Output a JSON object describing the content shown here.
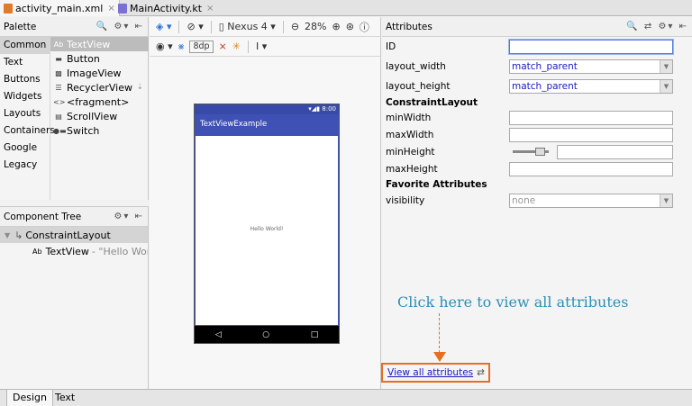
{
  "editor_tabs": [
    {
      "label": "activity_main.xml",
      "close": "×",
      "icon": "xml-file-icon",
      "color": "#e07b2a"
    },
    {
      "label": "MainActivity.kt",
      "close": "×",
      "icon": "kotlin-file-icon",
      "color": "#7b6fd6"
    }
  ],
  "palette": {
    "title": "Palette",
    "tools": "🔍 ⚙▾ ⇤",
    "categories": [
      "Common",
      "Text",
      "Buttons",
      "Widgets",
      "Layouts",
      "Containers",
      "Google",
      "Legacy"
    ],
    "items": [
      {
        "icon": "Ab",
        "label": "TextView"
      },
      {
        "icon": "▬",
        "label": "Button"
      },
      {
        "icon": "▩",
        "label": "ImageView"
      },
      {
        "icon": "☰",
        "label": "RecyclerView"
      },
      {
        "icon": "<>",
        "label": "<fragment>"
      },
      {
        "icon": "▤",
        "label": "ScrollView"
      },
      {
        "icon": "●▬",
        "label": "Switch"
      }
    ],
    "download_icon": "⇣"
  },
  "component_tree": {
    "title": "Component Tree",
    "tools": "⚙▾ ⇤",
    "root": {
      "toggle": "▼",
      "icon": "↳",
      "label": "ConstraintLayout"
    },
    "child": {
      "icon": "Ab",
      "label": "TextView",
      "detail": "- \"Hello World!\""
    }
  },
  "design_toolbar": {
    "row1": [
      "◈ ▾",
      "⊘ ▾",
      "▯ Nexus 4 ▾",
      "⊖",
      "28%",
      "⊕",
      "⊛",
      "ⓘ"
    ],
    "row2": [
      "◉ ▾",
      "⨳",
      "8dp",
      "⨯",
      "✳",
      "I ▾"
    ]
  },
  "preview": {
    "status_time": "▾◢▮ 8:00",
    "app_title": "TextViewExample",
    "text": "Hello World!",
    "nav": [
      "◁",
      "○",
      "□"
    ]
  },
  "attributes": {
    "title": "Attributes",
    "tools": "🔍 ⇄ ⚙▾ ⇤",
    "id_label": "ID",
    "id_value": "",
    "layout_width_label": "layout_width",
    "layout_width_value": "match_parent",
    "layout_height_label": "layout_height",
    "layout_height_value": "match_parent",
    "constraint_section": "ConstraintLayout",
    "min_width_label": "minWidth",
    "max_width_label": "maxWidth",
    "min_height_label": "minHeight",
    "max_height_label": "maxHeight",
    "favorite_section": "Favorite Attributes",
    "visibility_label": "visibility",
    "visibility_value": "none",
    "dropdown_arrow": "▼"
  },
  "hint": "Click here to view all attributes",
  "view_all": {
    "label": "View all attributes",
    "icon": "⇄"
  },
  "bottom_tabs": [
    "Design",
    "Text"
  ]
}
